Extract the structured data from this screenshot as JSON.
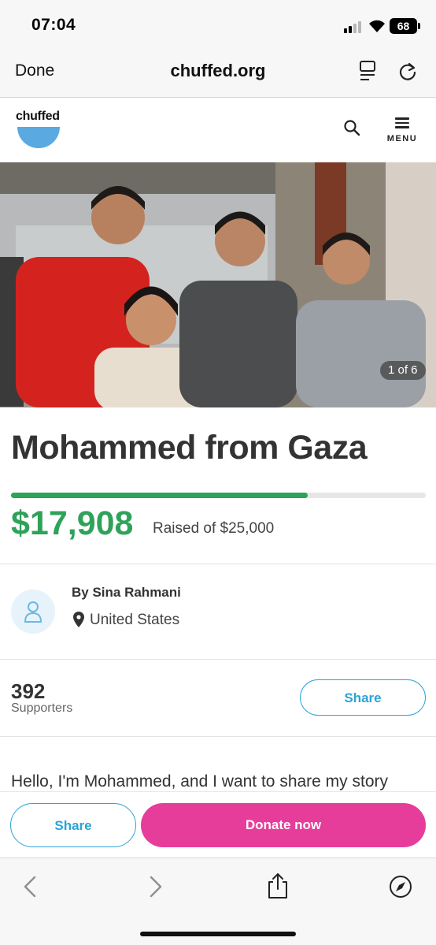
{
  "status_bar": {
    "time": "07:04",
    "battery": "68",
    "icons": [
      "signal-icon",
      "wifi-icon",
      "battery-icon"
    ]
  },
  "browser": {
    "done_label": "Done",
    "url": "chuffed.org",
    "icons": [
      "reader-icon",
      "reload-icon"
    ]
  },
  "site_header": {
    "logo_text": "chuffed",
    "menu_label": "MENU",
    "icons": [
      "search-icon",
      "hamburger-menu-icon"
    ]
  },
  "hero": {
    "photo_counter": "1 of 6"
  },
  "campaign": {
    "title": "Mohammed from Gaza",
    "raised": "$17,908",
    "raised_label": "Raised of $25,000",
    "progress_fraction": 0.716
  },
  "organizer": {
    "name": "By Sina Rahmani",
    "location": "United States"
  },
  "supporters": {
    "count": "392",
    "label": "Supporters",
    "share_label": "Share"
  },
  "story": {
    "first_line": "Hello, I'm Mohammed, and I want to share my story"
  },
  "actions": {
    "share_label": "Share",
    "donate_label": "Donate now"
  },
  "colors": {
    "accent_blue": "#2ba4d6",
    "progress_green": "#2fa25a",
    "donate_pink": "#e63d9b",
    "logo_blue": "#5aa9e0"
  },
  "toolbar": {
    "icons": [
      "back-icon",
      "forward-icon",
      "share-icon",
      "compass-icon"
    ]
  }
}
